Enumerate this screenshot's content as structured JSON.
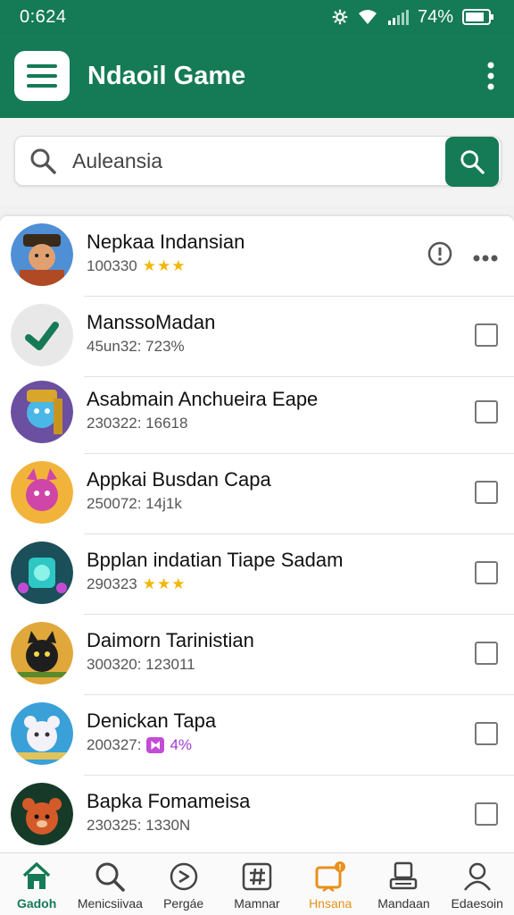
{
  "status": {
    "time": "0:624",
    "battery": "74%"
  },
  "appbar": {
    "title": "Ndaoil Game"
  },
  "search": {
    "value": "Auleansia"
  },
  "colors": {
    "primary": "#157a56",
    "star": "#f2b705",
    "accent_orange": "#e8901a"
  },
  "items": [
    {
      "title": "Nepkaa Indansian",
      "sub": "100330",
      "stars": "★★★"
    },
    {
      "title": "ManssoMadan",
      "sub": "45un32: 723%"
    },
    {
      "title": "Asabmain Anchueira Eape",
      "sub": "230322: 16618"
    },
    {
      "title": "Appkai Busdan Capa",
      "sub": "250072: 14j1k"
    },
    {
      "title": "Bpplan indatian Tiape Sadam",
      "sub": "290323",
      "stars": "★★★"
    },
    {
      "title": "Daimorn Tarinistian",
      "sub": "300320: 123011"
    },
    {
      "title": "Denickan Tapa",
      "sub": "200327:",
      "pct": "4%"
    },
    {
      "title": "Bapka Fomameisa",
      "sub": "230325: 1330N"
    }
  ],
  "nav": [
    {
      "label": "Gadoh",
      "icon": "home-icon"
    },
    {
      "label": "Menicsiivaa",
      "icon": "search-icon"
    },
    {
      "label": "Pergáe",
      "icon": "compass-icon"
    },
    {
      "label": "Mamnar",
      "icon": "hashtag-icon"
    },
    {
      "label": "Hnsana",
      "icon": "notification-icon"
    },
    {
      "label": "Mandaan",
      "icon": "storage-icon"
    },
    {
      "label": "Edaesoin",
      "icon": "profile-icon"
    }
  ]
}
